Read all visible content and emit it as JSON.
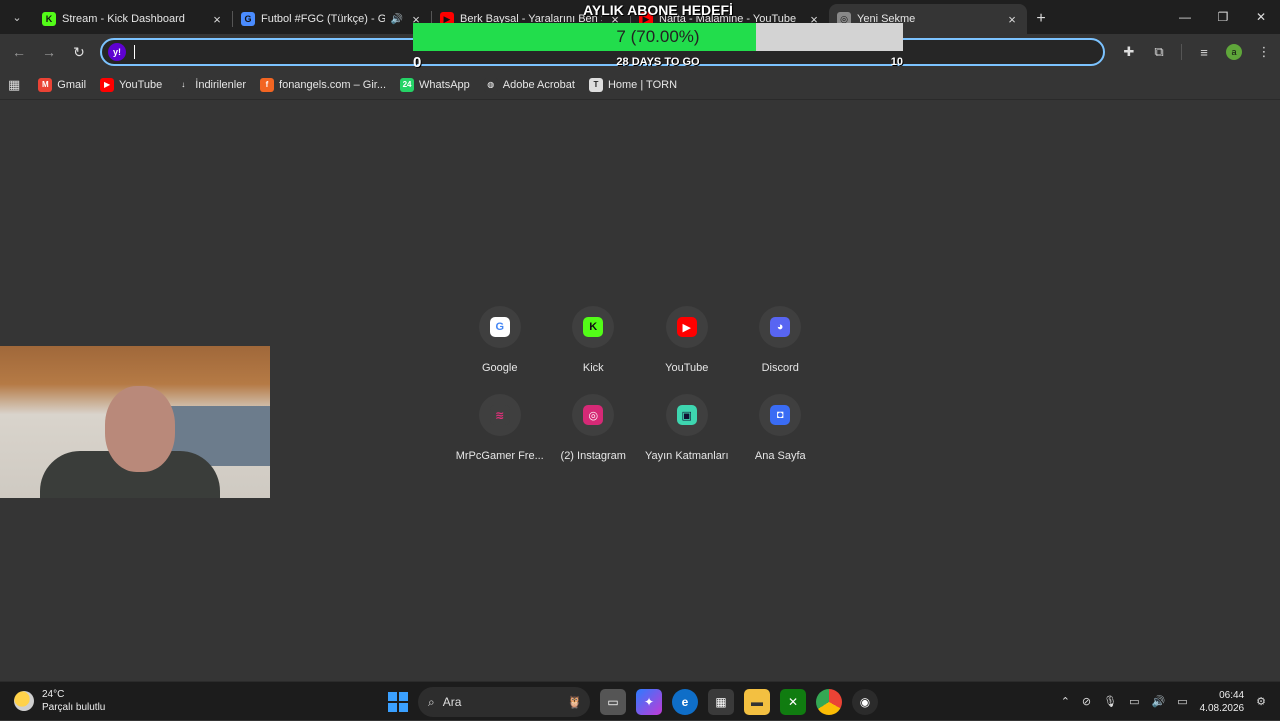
{
  "tabs": [
    {
      "title": "Stream - Kick Dashboard",
      "favicon": "K",
      "color": "#53fc18",
      "active": false
    },
    {
      "title": "Futbol #FGC (Türkçe) - Gar",
      "favicon": "G",
      "color": "#4a8cff",
      "active": false,
      "audio": true
    },
    {
      "title": "Berk Baysal - Yaralarını Ben Sar",
      "favicon": "▶",
      "color": "#ff0000",
      "active": false
    },
    {
      "title": "Narta - Malamine - YouTube",
      "favicon": "▶",
      "color": "#ff0000",
      "active": false
    },
    {
      "title": "Yeni Sekme",
      "favicon": "◎",
      "color": "#888888",
      "active": true
    }
  ],
  "omnibox": {
    "value": "",
    "engine_icon": "y!"
  },
  "profile_initial": "a",
  "bookmarks": [
    {
      "label": "Gmail",
      "icon": "M",
      "color": "#ea4335"
    },
    {
      "label": "YouTube",
      "icon": "▶",
      "color": "#ff0000"
    },
    {
      "label": "İndirilenler",
      "icon": "↓",
      "color": "#353535"
    },
    {
      "label": "fonangels.com – Gir...",
      "icon": "f",
      "color": "#f26522"
    },
    {
      "label": "WhatsApp",
      "icon": "24",
      "color": "#25d366"
    },
    {
      "label": "Adobe Acrobat",
      "icon": "◍",
      "color": "#353535"
    },
    {
      "label": "Home | TORN",
      "icon": "T",
      "color": "#dddddd"
    }
  ],
  "overlay": {
    "title": "AYLIK ABONE HEDEFİ",
    "progress_label": "7 (70.00%)",
    "progress_fraction": 0.7,
    "min_label": "0",
    "max_label": "10",
    "days_label": "28 DAYS TO GO",
    "fill_color": "#22dd4c"
  },
  "shortcuts": [
    {
      "label": "Google",
      "icon": "G",
      "color": "#ffffff",
      "text_color": "#4285f4"
    },
    {
      "label": "Kick",
      "icon": "K",
      "color": "#53fc18",
      "text_color": "#111111"
    },
    {
      "label": "YouTube",
      "icon": "▶",
      "color": "#ff0000",
      "text_color": "#ffffff"
    },
    {
      "label": "Discord",
      "icon": "◕",
      "color": "#5865f2",
      "text_color": "#ffffff"
    },
    {
      "label": "MrPcGamer Fre...",
      "icon": "≋",
      "color": "#3f3f3f",
      "text_color": "#e0307a"
    },
    {
      "label": "(2) Instagram",
      "icon": "◎",
      "color": "#d62976",
      "text_color": "#ffffff"
    },
    {
      "label": "Yayın Katmanları",
      "icon": "▣",
      "color": "#3ed6b0",
      "text_color": "#113"
    },
    {
      "label": "Ana Sayfa",
      "icon": "◘",
      "color": "#3a6cf4",
      "text_color": "#ffffff"
    }
  ],
  "taskbar": {
    "weather_temp": "24°C",
    "weather_desc": "Parçalı bulutlu",
    "search_label": "Ara",
    "time": "06:44",
    "date": "4.08.2026"
  }
}
